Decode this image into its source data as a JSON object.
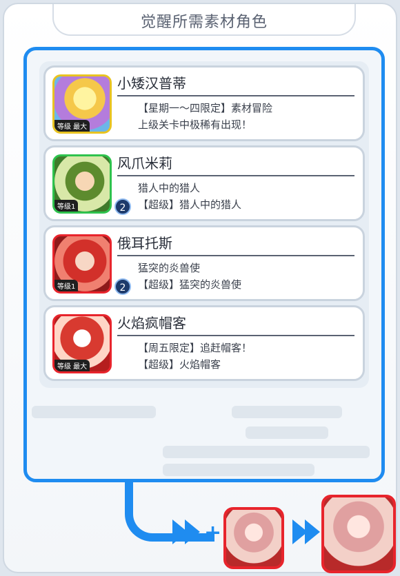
{
  "header": {
    "title": "觉醒所需素材角色"
  },
  "cards": [
    {
      "name": "小矮汉普蒂",
      "line1": "【星期一～四限定】素材冒险",
      "line2": "上级关卡中极稀有出现！",
      "level": "等级 最大",
      "count": ""
    },
    {
      "name": "风爪米莉",
      "line1": "猎人中的猎人",
      "line2": "【超级】猎人中的猎人",
      "level": "等级1",
      "count": "2"
    },
    {
      "name": "俄耳托斯",
      "line1": "猛突的炎兽使",
      "line2": "【超级】猛突的炎兽使",
      "level": "等级1",
      "count": "2"
    },
    {
      "name": "火焰疯帽客",
      "line1": "【周五限定】追赶帽客！",
      "line2": "【超级】火焰帽客",
      "level": "等级 最大",
      "count": ""
    }
  ]
}
